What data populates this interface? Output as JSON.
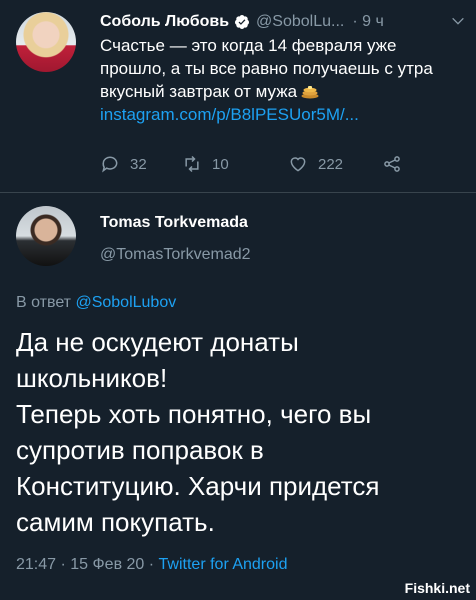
{
  "tweet1": {
    "display_name": "Соболь Любовь",
    "handle": "@SobolLu...",
    "time": "· 9 ч",
    "text": "Счастье — это когда 14 февраля уже прошло, а ты все равно получаешь с утра вкусный завтрак от мужа",
    "link": "instagram.com/p/B8lPESUor5M/...",
    "replies": "32",
    "retweets": "10",
    "likes": "222"
  },
  "tweet2": {
    "display_name": "Tomas Torkvemada",
    "handle": "@TomasTorkvemad2",
    "replying_prefix": "В ответ",
    "replying_to": "@SobolLubov",
    "text": "Да не оскудеют донаты\nшкольников!\nТеперь хоть понятно, чего вы\nсупротив поправок в\nКонституцию. Харчи придется\nсамим покупать.",
    "timestamp": "21:47 · 15 Фев 20 ·",
    "app": "Twitter for Android"
  },
  "watermark": "Fishki.net",
  "colors": {
    "background": "#15202b",
    "accent": "#1da1f2",
    "muted": "#8899a6"
  }
}
